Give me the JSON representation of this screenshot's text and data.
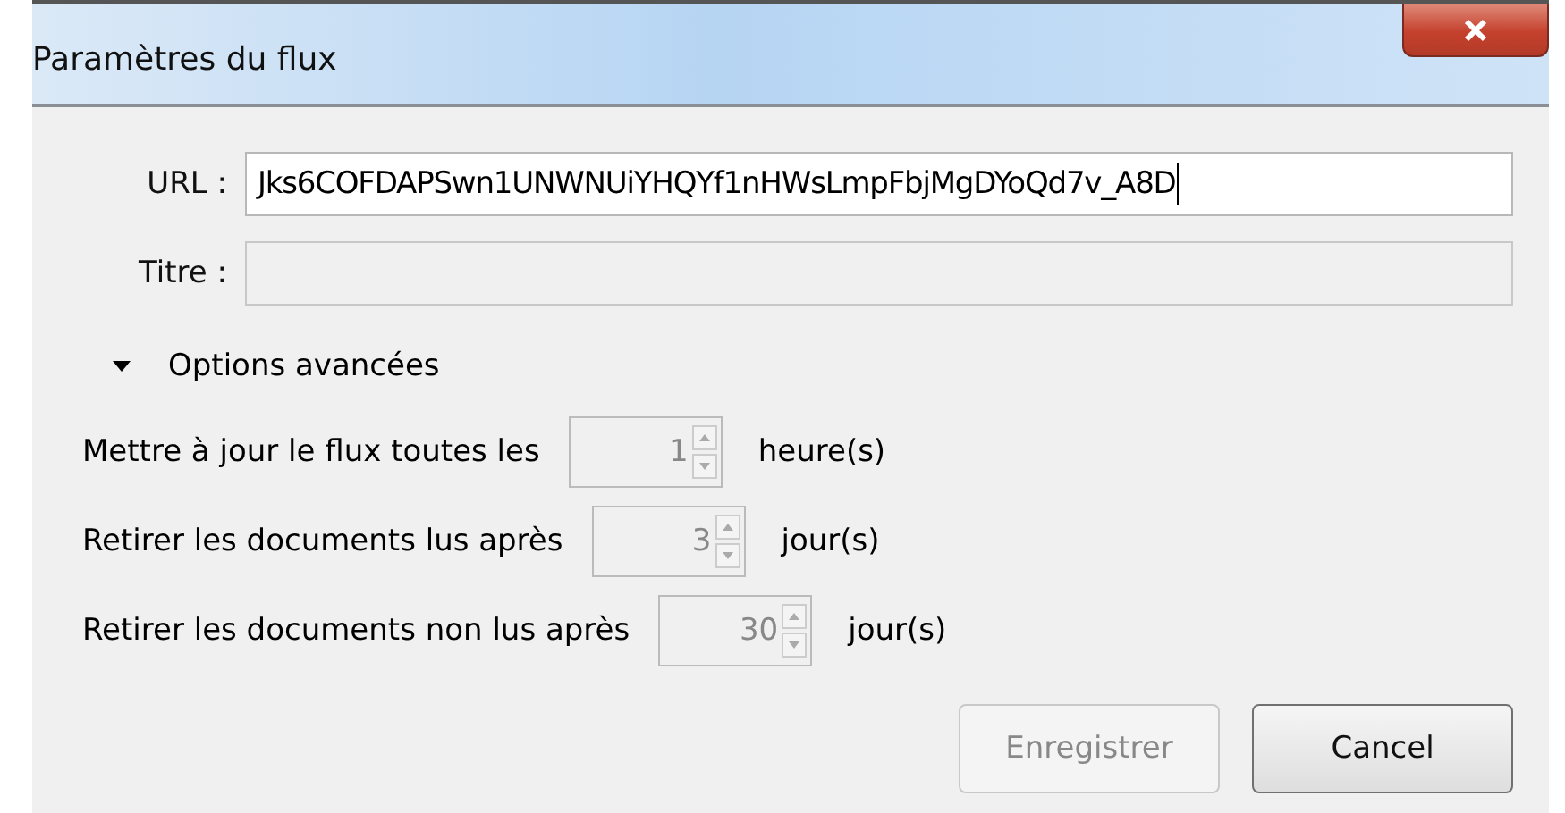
{
  "window": {
    "title": "Paramètres du flux"
  },
  "fields": [
    {
      "label": "URL :",
      "value": "Jks6COFDAPSwn1UNWNUiYHQYf1nHWsLmpFbjMgDYoQd7v_A8D",
      "disabled": false
    },
    {
      "label": "Titre :",
      "disabled": true
    }
  ],
  "advanced": {
    "label": "Options avancées",
    "expanded": true
  },
  "options": [
    {
      "label": "Mettre à jour le flux toutes les",
      "value": "1",
      "unit": "heure(s)",
      "disabled": true
    },
    {
      "label": "Retirer les documents lus après",
      "value": "3",
      "unit": "jour(s)",
      "disabled": true
    },
    {
      "label": "Retirer les documents non lus après",
      "value": "30",
      "unit": "jour(s)",
      "disabled": true
    }
  ],
  "buttons": [
    {
      "label": "Enregistrer",
      "disabled": true
    },
    {
      "label": "Cancel",
      "disabled": false
    }
  ]
}
